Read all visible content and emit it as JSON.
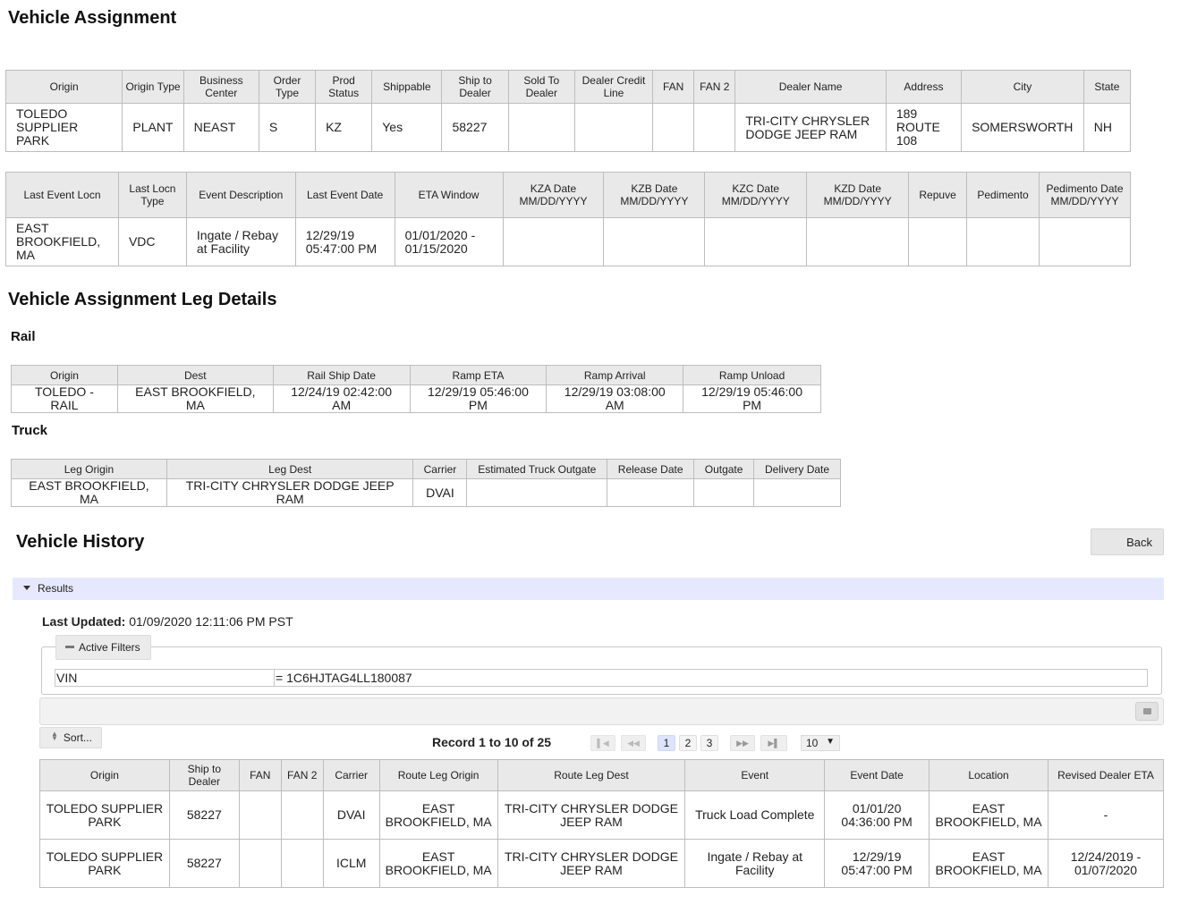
{
  "page": {
    "title": "Vehicle Assignment"
  },
  "assignment_table": {
    "headers": [
      "Origin",
      "Origin Type",
      "Business Center",
      "Order Type",
      "Prod Status",
      "Shippable",
      "Ship to Dealer",
      "Sold To Dealer",
      "Dealer Credit Line",
      "FAN",
      "FAN 2",
      "Dealer Name",
      "Address",
      "City",
      "State"
    ],
    "row": [
      "TOLEDO SUPPLIER PARK",
      "PLANT",
      "NEAST",
      "S",
      "KZ",
      "Yes",
      "58227",
      "",
      "",
      "",
      "",
      "TRI-CITY CHRYSLER DODGE JEEP RAM",
      "189 ROUTE 108",
      "SOMERSWORTH",
      "NH"
    ]
  },
  "event_table": {
    "headers": [
      "Last Event Locn",
      "Last Locn Type",
      "Event Description",
      "Last Event Date",
      "ETA Window",
      "KZA Date MM/DD/YYYY",
      "KZB Date MM/DD/YYYY",
      "KZC Date MM/DD/YYYY",
      "KZD Date MM/DD/YYYY",
      "Repuve",
      "Pedimento",
      "Pedimento Date MM/DD/YYYY"
    ],
    "row": [
      "EAST BROOKFIELD, MA",
      "VDC",
      "Ingate / Rebay at Facility",
      "12/29/19 05:47:00 PM",
      "01/01/2020 - 01/15/2020",
      "",
      "",
      "",
      "",
      "",
      "",
      ""
    ]
  },
  "leg_details": {
    "title": "Vehicle Assignment Leg Details",
    "rail": {
      "title": "Rail",
      "headers": [
        "Origin",
        "Dest",
        "Rail Ship Date",
        "Ramp ETA",
        "Ramp Arrival",
        "Ramp Unload"
      ],
      "row": [
        "TOLEDO - RAIL",
        "EAST BROOKFIELD, MA",
        "12/24/19 02:42:00 AM",
        "12/29/19 05:46:00 PM",
        "12/29/19 03:08:00 AM",
        "12/29/19 05:46:00 PM"
      ]
    },
    "truck": {
      "title": "Truck",
      "headers": [
        "Leg Origin",
        "Leg Dest",
        "Carrier",
        "Estimated Truck Outgate",
        "Release Date",
        "Outgate",
        "Delivery Date"
      ],
      "row": [
        "EAST BROOKFIELD, MA",
        "TRI-CITY CHRYSLER DODGE JEEP RAM",
        "DVAI",
        "",
        "",
        "",
        ""
      ]
    }
  },
  "history": {
    "title": "Vehicle History",
    "back_label": "Back",
    "results_label": "Results",
    "last_updated_label": "Last Updated:",
    "last_updated_value": "01/09/2020 12:11:06 PM PST",
    "active_filters_label": "Active Filters",
    "filter": {
      "key": "VIN",
      "value": "= 1C6HJTAG4LL180087"
    },
    "sort_label": "Sort...",
    "record_text": "Record 1 to 10 of 25",
    "pager": {
      "first": "▌◀",
      "prev": "◀◀",
      "pages": [
        "1",
        "2",
        "3"
      ],
      "next": "▶▶",
      "last": "▶▌",
      "page_size": "10",
      "page_size_arrow": "▼"
    },
    "headers": [
      "Origin",
      "Ship to Dealer",
      "FAN",
      "FAN 2",
      "Carrier",
      "Route Leg Origin",
      "Route Leg Dest",
      "Event",
      "Event Date",
      "Location",
      "Revised Dealer ETA"
    ],
    "rows": [
      [
        "TOLEDO SUPPLIER PARK",
        "58227",
        "",
        "",
        "DVAI",
        "EAST BROOKFIELD, MA",
        "TRI-CITY CHRYSLER DODGE JEEP RAM",
        "Truck Load Complete",
        "01/01/20 04:36:00 PM",
        "EAST BROOKFIELD, MA",
        "-"
      ],
      [
        "TOLEDO SUPPLIER PARK",
        "58227",
        "",
        "",
        "ICLM",
        "EAST BROOKFIELD, MA",
        "TRI-CITY CHRYSLER DODGE JEEP RAM",
        "Ingate / Rebay at Facility",
        "12/29/19 05:47:00 PM",
        "EAST BROOKFIELD, MA",
        "12/24/2019 - 01/07/2020"
      ]
    ]
  },
  "icons": {
    "collapse": "triangle-down-icon",
    "minus": "minus-icon",
    "print": "print-icon",
    "sort": "sort-icon"
  }
}
